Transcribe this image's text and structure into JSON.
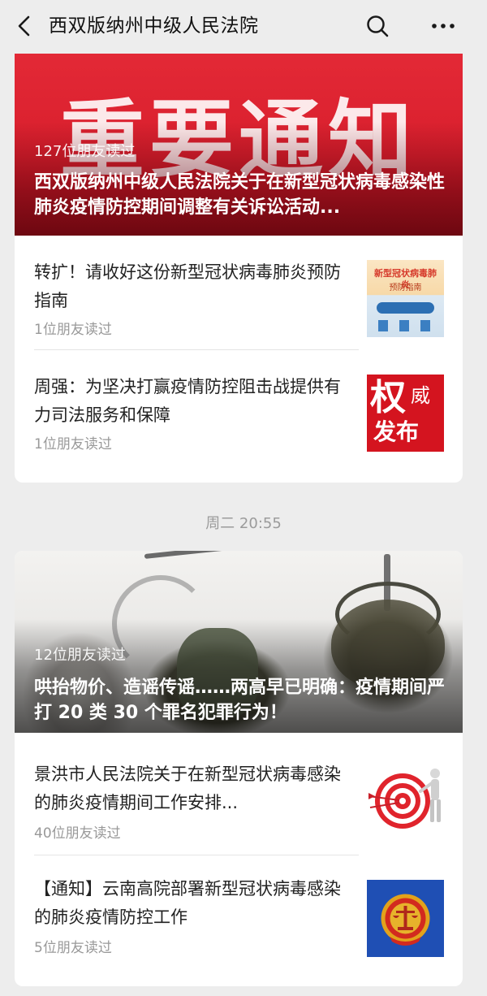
{
  "header": {
    "title": "西双版纳州中级人民法院",
    "back_icon": "chevron-left-icon",
    "search_icon": "search-icon",
    "more_icon": "more-horizontal-icon"
  },
  "cards": [
    {
      "cover": {
        "banner_text": "重要通知",
        "reads": "127位朋友读过",
        "title": "西双版纳州中级人民法院关于在新型冠状病毒感染性肺炎疫情防控期间调整有关诉讼活动..."
      },
      "items": [
        {
          "title": "转扩！请收好这份新型冠状病毒肺炎预防指南",
          "reads": "1位朋友读过",
          "thumb": {
            "line1": "新型冠状病毒肺炎",
            "line2": "预防指南"
          }
        },
        {
          "title": "周强：为坚决打赢疫情防控阻击战提供有力司法服务和保障",
          "reads": "1位朋友读过",
          "thumb": {
            "char1": "权",
            "char2": "威",
            "line2": "发布"
          }
        }
      ]
    },
    {
      "cover": {
        "reads": "12位朋友读过",
        "title": "哄抬物价、造谣传谣……两高早已明确：疫情期间严打 20 类 30 个罪名犯罪行为！"
      },
      "items": [
        {
          "title": "景洪市人民法院关于在新型冠状病毒感染的肺炎疫情期间工作安排...",
          "reads": "40位朋友读过",
          "thumb": {
            "icon": "target-arrow-icon"
          }
        },
        {
          "title": "【通知】云南高院部署新型冠状病毒感染的肺炎疫情防控工作",
          "reads": "5位朋友读过",
          "thumb": {
            "icon": "court-emblem-icon"
          }
        }
      ]
    }
  ],
  "timestamp": "周二 20:55",
  "colors": {
    "background": "#ededed",
    "card": "#ffffff",
    "banner_red": "#e32936",
    "muted_text": "#999999",
    "emblem_blue": "#1f4fb4"
  }
}
